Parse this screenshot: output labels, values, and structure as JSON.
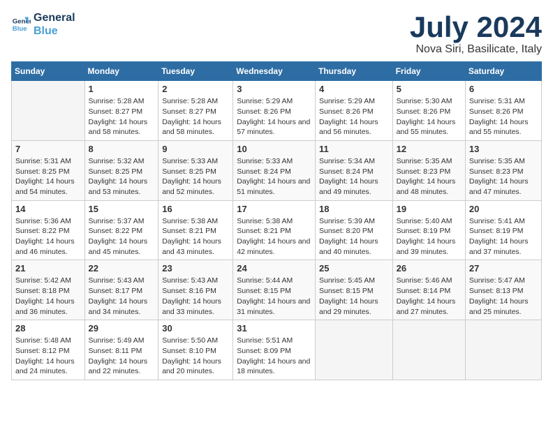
{
  "logo": {
    "line1": "General",
    "line2": "Blue"
  },
  "title": "July 2024",
  "location": "Nova Siri, Basilicate, Italy",
  "weekdays": [
    "Sunday",
    "Monday",
    "Tuesday",
    "Wednesday",
    "Thursday",
    "Friday",
    "Saturday"
  ],
  "weeks": [
    [
      {
        "date": "",
        "sunrise": "",
        "sunset": "",
        "daylight": ""
      },
      {
        "date": "1",
        "sunrise": "Sunrise: 5:28 AM",
        "sunset": "Sunset: 8:27 PM",
        "daylight": "Daylight: 14 hours and 58 minutes."
      },
      {
        "date": "2",
        "sunrise": "Sunrise: 5:28 AM",
        "sunset": "Sunset: 8:27 PM",
        "daylight": "Daylight: 14 hours and 58 minutes."
      },
      {
        "date": "3",
        "sunrise": "Sunrise: 5:29 AM",
        "sunset": "Sunset: 8:26 PM",
        "daylight": "Daylight: 14 hours and 57 minutes."
      },
      {
        "date": "4",
        "sunrise": "Sunrise: 5:29 AM",
        "sunset": "Sunset: 8:26 PM",
        "daylight": "Daylight: 14 hours and 56 minutes."
      },
      {
        "date": "5",
        "sunrise": "Sunrise: 5:30 AM",
        "sunset": "Sunset: 8:26 PM",
        "daylight": "Daylight: 14 hours and 55 minutes."
      },
      {
        "date": "6",
        "sunrise": "Sunrise: 5:31 AM",
        "sunset": "Sunset: 8:26 PM",
        "daylight": "Daylight: 14 hours and 55 minutes."
      }
    ],
    [
      {
        "date": "7",
        "sunrise": "Sunrise: 5:31 AM",
        "sunset": "Sunset: 8:25 PM",
        "daylight": "Daylight: 14 hours and 54 minutes."
      },
      {
        "date": "8",
        "sunrise": "Sunrise: 5:32 AM",
        "sunset": "Sunset: 8:25 PM",
        "daylight": "Daylight: 14 hours and 53 minutes."
      },
      {
        "date": "9",
        "sunrise": "Sunrise: 5:33 AM",
        "sunset": "Sunset: 8:25 PM",
        "daylight": "Daylight: 14 hours and 52 minutes."
      },
      {
        "date": "10",
        "sunrise": "Sunrise: 5:33 AM",
        "sunset": "Sunset: 8:24 PM",
        "daylight": "Daylight: 14 hours and 51 minutes."
      },
      {
        "date": "11",
        "sunrise": "Sunrise: 5:34 AM",
        "sunset": "Sunset: 8:24 PM",
        "daylight": "Daylight: 14 hours and 49 minutes."
      },
      {
        "date": "12",
        "sunrise": "Sunrise: 5:35 AM",
        "sunset": "Sunset: 8:23 PM",
        "daylight": "Daylight: 14 hours and 48 minutes."
      },
      {
        "date": "13",
        "sunrise": "Sunrise: 5:35 AM",
        "sunset": "Sunset: 8:23 PM",
        "daylight": "Daylight: 14 hours and 47 minutes."
      }
    ],
    [
      {
        "date": "14",
        "sunrise": "Sunrise: 5:36 AM",
        "sunset": "Sunset: 8:22 PM",
        "daylight": "Daylight: 14 hours and 46 minutes."
      },
      {
        "date": "15",
        "sunrise": "Sunrise: 5:37 AM",
        "sunset": "Sunset: 8:22 PM",
        "daylight": "Daylight: 14 hours and 45 minutes."
      },
      {
        "date": "16",
        "sunrise": "Sunrise: 5:38 AM",
        "sunset": "Sunset: 8:21 PM",
        "daylight": "Daylight: 14 hours and 43 minutes."
      },
      {
        "date": "17",
        "sunrise": "Sunrise: 5:38 AM",
        "sunset": "Sunset: 8:21 PM",
        "daylight": "Daylight: 14 hours and 42 minutes."
      },
      {
        "date": "18",
        "sunrise": "Sunrise: 5:39 AM",
        "sunset": "Sunset: 8:20 PM",
        "daylight": "Daylight: 14 hours and 40 minutes."
      },
      {
        "date": "19",
        "sunrise": "Sunrise: 5:40 AM",
        "sunset": "Sunset: 8:19 PM",
        "daylight": "Daylight: 14 hours and 39 minutes."
      },
      {
        "date": "20",
        "sunrise": "Sunrise: 5:41 AM",
        "sunset": "Sunset: 8:19 PM",
        "daylight": "Daylight: 14 hours and 37 minutes."
      }
    ],
    [
      {
        "date": "21",
        "sunrise": "Sunrise: 5:42 AM",
        "sunset": "Sunset: 8:18 PM",
        "daylight": "Daylight: 14 hours and 36 minutes."
      },
      {
        "date": "22",
        "sunrise": "Sunrise: 5:43 AM",
        "sunset": "Sunset: 8:17 PM",
        "daylight": "Daylight: 14 hours and 34 minutes."
      },
      {
        "date": "23",
        "sunrise": "Sunrise: 5:43 AM",
        "sunset": "Sunset: 8:16 PM",
        "daylight": "Daylight: 14 hours and 33 minutes."
      },
      {
        "date": "24",
        "sunrise": "Sunrise: 5:44 AM",
        "sunset": "Sunset: 8:15 PM",
        "daylight": "Daylight: 14 hours and 31 minutes."
      },
      {
        "date": "25",
        "sunrise": "Sunrise: 5:45 AM",
        "sunset": "Sunset: 8:15 PM",
        "daylight": "Daylight: 14 hours and 29 minutes."
      },
      {
        "date": "26",
        "sunrise": "Sunrise: 5:46 AM",
        "sunset": "Sunset: 8:14 PM",
        "daylight": "Daylight: 14 hours and 27 minutes."
      },
      {
        "date": "27",
        "sunrise": "Sunrise: 5:47 AM",
        "sunset": "Sunset: 8:13 PM",
        "daylight": "Daylight: 14 hours and 25 minutes."
      }
    ],
    [
      {
        "date": "28",
        "sunrise": "Sunrise: 5:48 AM",
        "sunset": "Sunset: 8:12 PM",
        "daylight": "Daylight: 14 hours and 24 minutes."
      },
      {
        "date": "29",
        "sunrise": "Sunrise: 5:49 AM",
        "sunset": "Sunset: 8:11 PM",
        "daylight": "Daylight: 14 hours and 22 minutes."
      },
      {
        "date": "30",
        "sunrise": "Sunrise: 5:50 AM",
        "sunset": "Sunset: 8:10 PM",
        "daylight": "Daylight: 14 hours and 20 minutes."
      },
      {
        "date": "31",
        "sunrise": "Sunrise: 5:51 AM",
        "sunset": "Sunset: 8:09 PM",
        "daylight": "Daylight: 14 hours and 18 minutes."
      },
      {
        "date": "",
        "sunrise": "",
        "sunset": "",
        "daylight": ""
      },
      {
        "date": "",
        "sunrise": "",
        "sunset": "",
        "daylight": ""
      },
      {
        "date": "",
        "sunrise": "",
        "sunset": "",
        "daylight": ""
      }
    ]
  ]
}
